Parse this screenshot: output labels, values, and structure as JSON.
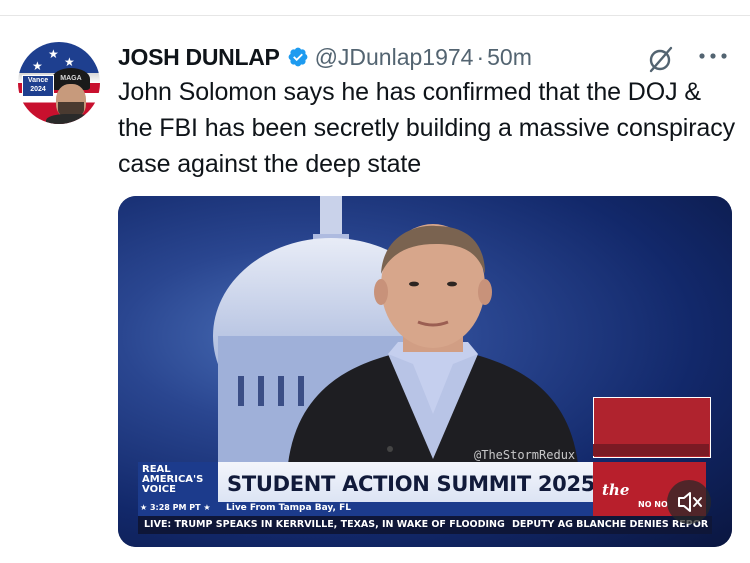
{
  "author": {
    "name": "JOSH DUNLAP",
    "handle": "@JDunlap1974",
    "separator": "·",
    "time": "50m",
    "avatar_badge_text": "Vance 2024",
    "avatar_hat_text": "MAGA"
  },
  "tweet": {
    "text": "John Solomon says he has confirmed that the DOJ & the FBI has been secretly building a massive conspiracy case against the deep state"
  },
  "media": {
    "watermark": "@TheStormRedux",
    "network_logo": "REAL AMERICA'S VOICE",
    "headline": "STUDENT ACTION SUMMIT 2025",
    "timestamp": "★ 3:28 PM PT ★",
    "location": "Live From Tampa Bay, FL",
    "ticker_left": "LIVE: TRUMP SPEAKS IN KERRVILLE, TEXAS, IN WAKE OF FLOODING",
    "ticker_right": "DEPUTY AG BLANCHE DENIES REPOR",
    "ad_text": "the",
    "ad_subtext": "NO NO"
  },
  "icons": {
    "verified": "verified-badge-icon",
    "grok": "grok-icon",
    "more": "more-icon",
    "mute": "speaker-muted-icon"
  },
  "colors": {
    "verified_blue": "#1d9bf0",
    "secondary_text": "#536471",
    "primary_text": "#0f1419"
  }
}
